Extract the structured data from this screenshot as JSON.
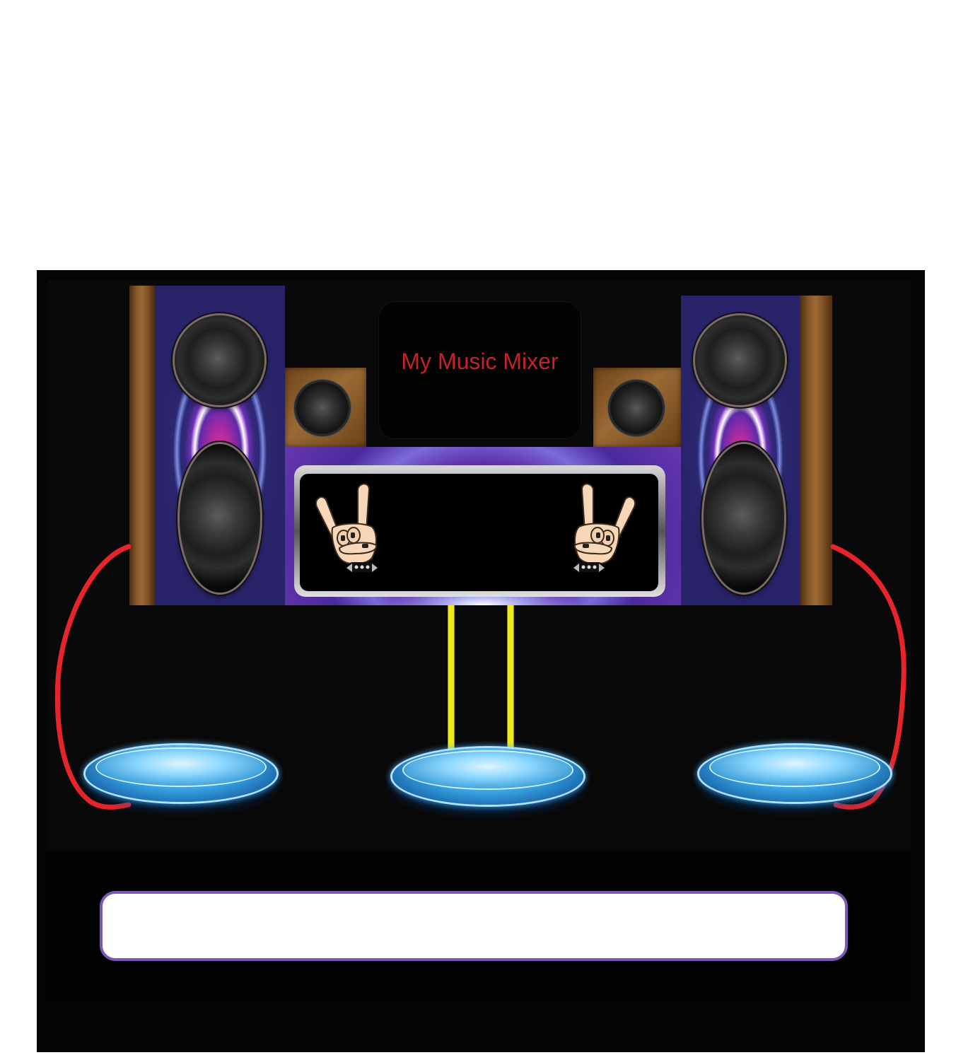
{
  "app": {
    "title": "My Music Mixer"
  },
  "input": {
    "value": "",
    "placeholder": ""
  },
  "colors": {
    "title_text": "#c3232b",
    "cable": "#e8242b",
    "wire": "#f1ea1a",
    "input_border": "#7a58b8",
    "pad_glow": "#3aa6e6"
  },
  "icons": [
    "rock-hand-icon",
    "speaker-woofer-icon",
    "speaker-tweeter-icon",
    "drum-pad-icon"
  ]
}
